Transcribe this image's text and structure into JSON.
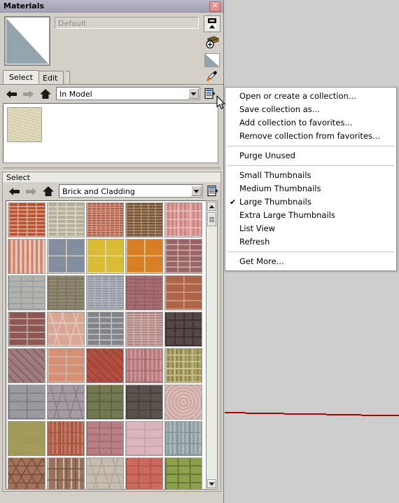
{
  "window": {
    "title": "Materials",
    "close_label": "✕"
  },
  "material": {
    "name_value": "Default",
    "preview_icon": "material-preview-swatch"
  },
  "toolbar": {
    "secondary_pane_icon": "display-secondary-pane-icon",
    "create_material_icon": "create-material-icon",
    "swatch_icon": "material-swatch-icon",
    "eyedropper_icon": "eyedropper-icon"
  },
  "tabs": [
    {
      "label": "Select",
      "active": true
    },
    {
      "label": "Edit",
      "active": false
    }
  ],
  "primary_nav": {
    "back_icon": "back-arrow-icon",
    "forward_icon": "forward-arrow-icon",
    "home_icon": "home-icon",
    "collection_value": "In Model",
    "dropdown_icon": "chevron-down-icon",
    "details_icon": "details-icon"
  },
  "in_model": {
    "swatches": [
      {
        "name": "in-model-material-1",
        "color": "#dcd6b4"
      }
    ]
  },
  "secondary": {
    "header": "Select",
    "nav": {
      "back_icon": "back-arrow-icon",
      "forward_icon": "forward-arrow-icon",
      "home_icon": "home-icon",
      "collection_value": "Brick and Cladding",
      "dropdown_icon": "chevron-down-icon",
      "details_icon": "details-icon"
    }
  },
  "scrollbar": {
    "up_icon": "scroll-up-icon",
    "down_icon": "scroll-down-icon",
    "thumb_icon": "scroll-thumb-grip"
  },
  "context_menu": {
    "items": [
      {
        "label": "Open or create a collection...",
        "checked": false,
        "type": "item"
      },
      {
        "label": "Save collection as...",
        "checked": false,
        "type": "item"
      },
      {
        "label": "Add collection to favorites...",
        "checked": false,
        "type": "item"
      },
      {
        "label": "Remove collection from favorites...",
        "checked": false,
        "type": "item"
      },
      {
        "type": "separator"
      },
      {
        "label": "Purge Unused",
        "checked": false,
        "type": "item"
      },
      {
        "type": "separator"
      },
      {
        "label": "Small Thumbnails",
        "checked": false,
        "type": "item"
      },
      {
        "label": "Medium Thumbnails",
        "checked": false,
        "type": "item"
      },
      {
        "label": "Large Thumbnails",
        "checked": true,
        "type": "item"
      },
      {
        "label": "Extra Large Thumbnails",
        "checked": false,
        "type": "item"
      },
      {
        "label": "List View",
        "checked": false,
        "type": "item"
      },
      {
        "label": "Refresh",
        "checked": false,
        "type": "item"
      },
      {
        "type": "separator"
      },
      {
        "label": "Get More...",
        "checked": false,
        "type": "item"
      }
    ],
    "check_glyph": "✔"
  },
  "materials_grid": {
    "columns": 5,
    "swatches": [
      {
        "name": "brick-rough-red",
        "base": "#c0461f",
        "mortar": "#e4b49a",
        "pattern": "brick",
        "rows": 9,
        "cols": 4
      },
      {
        "name": "brick-tan-block",
        "base": "#b9b49a",
        "mortar": "#e8e4d2",
        "pattern": "brick",
        "rows": 8,
        "cols": 4
      },
      {
        "name": "brick-small-red",
        "base": "#b34b33",
        "mortar": "#d99a84",
        "pattern": "brick",
        "rows": 14,
        "cols": 8
      },
      {
        "name": "brick-dark-brown",
        "base": "#6d4426",
        "mortar": "#b08a62",
        "pattern": "brick",
        "rows": 12,
        "cols": 5
      },
      {
        "name": "brick-pink-basketweave",
        "base": "#ea8f8a",
        "mortar": "#f6c7c3",
        "pattern": "basket",
        "rows": 4,
        "cols": 3
      },
      {
        "name": "brick-soldier-course",
        "base": "#d9785c",
        "mortar": "#f0cdbc",
        "pattern": "vertical",
        "rows": 2,
        "cols": 8
      },
      {
        "name": "brick-blue-speckle",
        "base": "#7d8a9e",
        "mortar": "#ddd9c4",
        "pattern": "brick",
        "rows": 2,
        "cols": 2
      },
      {
        "name": "brick-yellow-glaze",
        "base": "#e3c023",
        "mortar": "#f2e9b5",
        "pattern": "brick",
        "rows": 2,
        "cols": 2
      },
      {
        "name": "brick-orange-glaze",
        "base": "#e07a10",
        "mortar": "#f0d090",
        "pattern": "brick",
        "rows": 2,
        "cols": 2
      },
      {
        "name": "brick-mauve-running",
        "base": "#9b5a5c",
        "mortar": "#cfb7b2",
        "pattern": "brick",
        "rows": 6,
        "cols": 3
      },
      {
        "name": "stone-grey-rough",
        "base": "#b8b5ab",
        "mortar": "#8f9fa8",
        "pattern": "brick",
        "rows": 6,
        "cols": 3
      },
      {
        "name": "brick-olive-weathered",
        "base": "#8e8468",
        "mortar": "#6f6b54",
        "pattern": "brick",
        "rows": 10,
        "cols": 4
      },
      {
        "name": "brick-grey-thin",
        "base": "#8e94a0",
        "mortar": "#b7bcc4",
        "pattern": "brick",
        "rows": 14,
        "cols": 5
      },
      {
        "name": "brick-mottled-rose",
        "base": "#a9646a",
        "mortar": "#8e5359",
        "pattern": "brick",
        "rows": 9,
        "cols": 4
      },
      {
        "name": "brick-terracotta-large",
        "base": "#b35a3c",
        "mortar": "#d9a186",
        "pattern": "brick",
        "rows": 4,
        "cols": 2
      },
      {
        "name": "brick-maroon-running",
        "base": "#8d4a4a",
        "mortar": "#c8b0a6",
        "pattern": "brick",
        "rows": 5,
        "cols": 2
      },
      {
        "name": "stone-pink-rubble",
        "base": "#e3a893",
        "mortar": "#f0d9c8",
        "pattern": "rubble",
        "rows": 3,
        "cols": 2
      },
      {
        "name": "block-grey-concrete",
        "base": "#7e8187",
        "mortar": "#c9ccd0",
        "pattern": "brick",
        "rows": 6,
        "cols": 3
      },
      {
        "name": "brick-rose-thin",
        "base": "#b07c78",
        "mortar": "#d7b3ae",
        "pattern": "brick",
        "rows": 14,
        "cols": 5
      },
      {
        "name": "tile-dark-square",
        "base": "#4a3a38",
        "mortar": "#2b211f",
        "pattern": "grid",
        "rows": 4,
        "cols": 4
      },
      {
        "name": "paver-herringbone-mauve",
        "base": "#9e7577",
        "mortar": "#6f5354",
        "pattern": "herringbone",
        "rows": 8,
        "cols": 6
      },
      {
        "name": "brick-salmon-large",
        "base": "#e28c6d",
        "mortar": "#cfbda8",
        "pattern": "brick",
        "rows": 4,
        "cols": 2
      },
      {
        "name": "paver-diagonal-red",
        "base": "#b5402f",
        "mortar": "#8a3526",
        "pattern": "herringbone",
        "rows": 4,
        "cols": 3
      },
      {
        "name": "paver-pink-block",
        "base": "#cf8084",
        "mortar": "#a66468",
        "pattern": "basket",
        "rows": 3,
        "cols": 2
      },
      {
        "name": "paver-olive-weave",
        "base": "#a09443",
        "mortar": "#d4cb96",
        "pattern": "basket",
        "rows": 5,
        "cols": 4
      },
      {
        "name": "paver-grey-stagger",
        "base": "#9b99a0",
        "mortar": "#76747c",
        "pattern": "brick",
        "rows": 4,
        "cols": 2
      },
      {
        "name": "paver-lilac-random",
        "base": "#a59aa4",
        "mortar": "#7e7480",
        "pattern": "rubble",
        "rows": 4,
        "cols": 3
      },
      {
        "name": "paver-mossy-green",
        "base": "#6d7244",
        "mortar": "#4e5230",
        "pattern": "brick",
        "rows": 4,
        "cols": 3
      },
      {
        "name": "paver-charcoal-wet",
        "base": "#4f463f",
        "mortar": "#332d28",
        "pattern": "brick",
        "rows": 4,
        "cols": 3
      },
      {
        "name": "tile-pink-dotted",
        "base": "#e3bfb8",
        "mortar": "#c99a93",
        "pattern": "dots",
        "rows": 9,
        "cols": 9
      },
      {
        "name": "stucco-olive-plain",
        "base": "#a39a4e",
        "mortar": "#8d8444",
        "pattern": "plain",
        "rows": 1,
        "cols": 1
      },
      {
        "name": "paver-orange-basket",
        "base": "#c4573a",
        "mortar": "#a04830",
        "pattern": "basket",
        "rows": 3,
        "cols": 3
      },
      {
        "name": "paver-rose-running",
        "base": "#bd7b80",
        "mortar": "#9a6166",
        "pattern": "brick",
        "rows": 5,
        "cols": 3
      },
      {
        "name": "paver-pale-pink",
        "base": "#e5b9c0",
        "mortar": "#cfa1a8",
        "pattern": "brick",
        "rows": 4,
        "cols": 2
      },
      {
        "name": "paver-bluegrey-weave",
        "base": "#9fb0b3",
        "mortar": "#7d8f93",
        "pattern": "basket",
        "rows": 3,
        "cols": 3
      },
      {
        "name": "paver-hexagon-brown",
        "base": "#a56a4d",
        "mortar": "#6d4430",
        "pattern": "hex",
        "rows": 4,
        "cols": 3
      },
      {
        "name": "brick-with-vents",
        "base": "#9a6a50",
        "mortar": "#6e4a36",
        "pattern": "vents",
        "rows": 3,
        "cols": 4
      },
      {
        "name": "paver-sand-random",
        "base": "#cdc1b4",
        "mortar": "#aea294",
        "pattern": "rubble",
        "rows": 4,
        "cols": 3
      },
      {
        "name": "paver-coral-block",
        "base": "#d4604f",
        "mortar": "#a84a3c",
        "pattern": "brick",
        "rows": 4,
        "cols": 3
      },
      {
        "name": "paver-green-grid",
        "base": "#8aa03c",
        "mortar": "#5f7028",
        "pattern": "grid",
        "rows": 4,
        "cols": 3
      }
    ]
  }
}
